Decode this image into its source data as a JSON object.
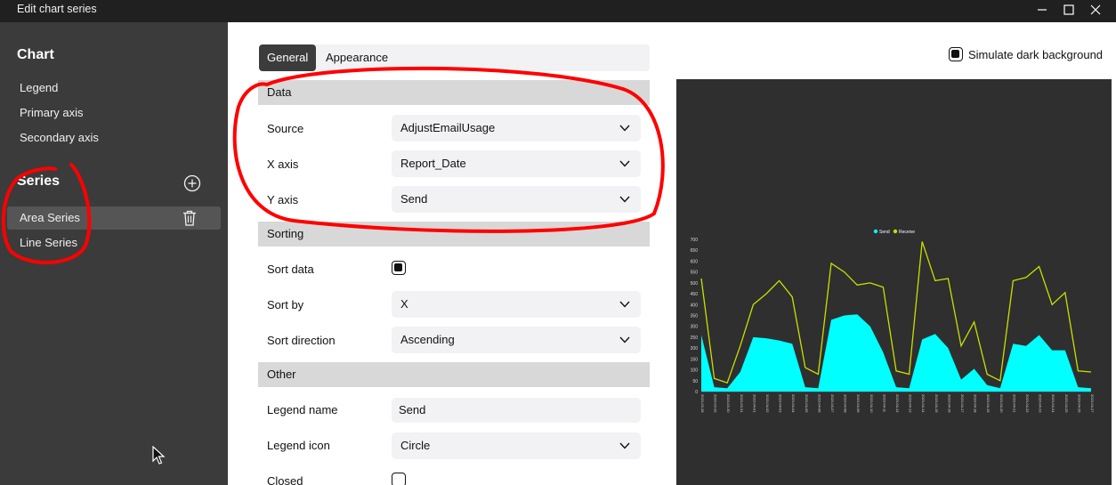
{
  "window": {
    "title": "Edit chart series"
  },
  "sidebar": {
    "chart_heading": "Chart",
    "chart_items": [
      {
        "label": "Legend"
      },
      {
        "label": "Primary axis"
      },
      {
        "label": "Secondary axis"
      }
    ],
    "series_heading": "Series",
    "series_items": [
      {
        "label": "Area Series",
        "selected": true
      },
      {
        "label": "Line Series",
        "selected": false
      }
    ]
  },
  "tabs": [
    {
      "label": "General",
      "active": true
    },
    {
      "label": "Appearance",
      "active": false
    }
  ],
  "dark_background": {
    "label": "Simulate dark background",
    "checked": true
  },
  "sections": {
    "data": {
      "title": "Data",
      "source": {
        "label": "Source",
        "value": "AdjustEmailUsage"
      },
      "x_axis": {
        "label": "X axis",
        "value": "Report_Date"
      },
      "y_axis": {
        "label": "Y axis",
        "value": "Send"
      }
    },
    "sorting": {
      "title": "Sorting",
      "sort_data": {
        "label": "Sort data",
        "checked": true
      },
      "sort_by": {
        "label": "Sort by",
        "value": "X"
      },
      "sort_direction": {
        "label": "Sort direction",
        "value": "Ascending"
      }
    },
    "other": {
      "title": "Other",
      "legend_name": {
        "label": "Legend name",
        "value": "Send"
      },
      "legend_icon": {
        "label": "Legend icon",
        "value": "Circle"
      },
      "closed": {
        "label": "Closed",
        "checked": false
      }
    }
  },
  "colors": {
    "send_area": "#00ffff",
    "receive_line": "#c8e000",
    "annotation": "#ff0000",
    "preview_bg": "#2f2f2f"
  },
  "chart_data": {
    "type": "area",
    "legend": [
      "Send",
      "Receive"
    ],
    "legend_placement": "top-center",
    "ylim": [
      0,
      700
    ],
    "y_ticks": [
      0,
      50,
      100,
      150,
      200,
      250,
      300,
      350,
      400,
      450,
      500,
      550,
      600,
      650,
      700
    ],
    "x": [
      "2023-03-28",
      "2023-03-29",
      "2023-03-30",
      "2023-03-31",
      "2023-04-01",
      "2023-04-02",
      "2023-04-03",
      "2023-04-04",
      "2023-04-05",
      "2023-04-06",
      "2023-04-07",
      "2023-04-08",
      "2023-04-09",
      "2023-04-10",
      "2023-04-11",
      "2023-04-12",
      "2023-04-13",
      "2023-04-14",
      "2023-04-15",
      "2023-04-16",
      "2023-04-17",
      "2023-04-18",
      "2023-04-19",
      "2023-04-20",
      "2023-04-21",
      "2023-04-22",
      "2023-04-23",
      "2023-04-24",
      "2023-04-25",
      "2023-04-26",
      "2023-04-27"
    ],
    "series": [
      {
        "name": "Send",
        "kind": "area",
        "values": [
          260,
          20,
          15,
          90,
          250,
          245,
          235,
          220,
          20,
          15,
          330,
          350,
          355,
          300,
          180,
          20,
          15,
          240,
          265,
          200,
          55,
          105,
          30,
          15,
          220,
          210,
          260,
          190,
          190,
          20,
          15
        ]
      },
      {
        "name": "Receive",
        "kind": "line",
        "values": [
          520,
          60,
          40,
          210,
          400,
          450,
          510,
          435,
          110,
          80,
          590,
          550,
          490,
          500,
          480,
          95,
          80,
          690,
          510,
          520,
          210,
          320,
          80,
          50,
          510,
          525,
          575,
          400,
          455,
          95,
          90
        ]
      }
    ]
  }
}
